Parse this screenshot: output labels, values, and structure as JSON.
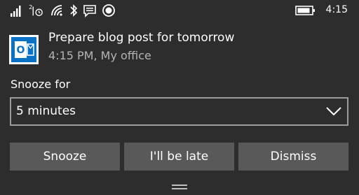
{
  "status_bar": {
    "time": "4:15",
    "icons": [
      "signal-bars-icon",
      "cellular-data-icon",
      "wifi-icon",
      "bluetooth-icon",
      "message-icon",
      "record-icon",
      "battery-icon"
    ]
  },
  "notification": {
    "app_icon": "outlook-icon",
    "title": "Prepare blog post for tomorrow",
    "subtitle": "4:15 PM, My office",
    "snooze_label": "Snooze for",
    "snooze_value": "5 minutes",
    "buttons": [
      "Snooze",
      "I'll be late",
      "Dismiss"
    ]
  },
  "colors": {
    "background": "#2d2d2d",
    "button": "#595959",
    "outlook_blue": "#0a72c6",
    "select_border": "#9b9b9b"
  }
}
